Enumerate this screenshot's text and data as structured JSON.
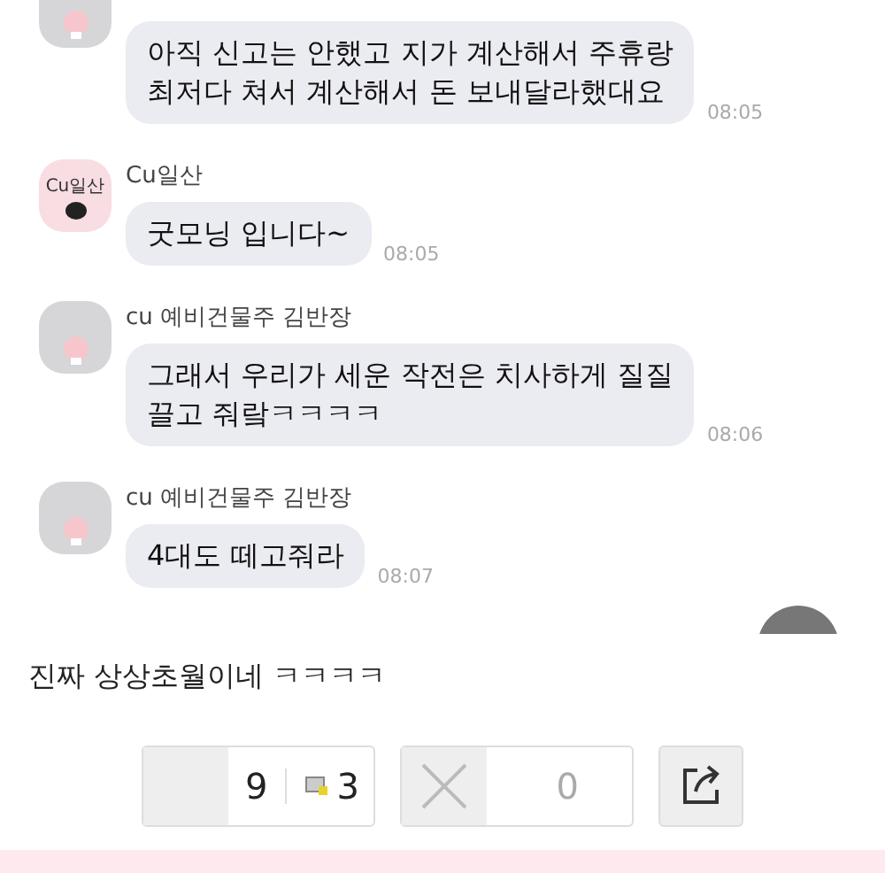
{
  "messages": [
    {
      "avatar": {
        "kind": "peach"
      },
      "text": "아직 신고는 안했고 지가 계산해서 주휴랑\n최저다 쳐서 계산해서 돈 보내달라했대요",
      "time": "08:05"
    },
    {
      "sender": "Cu일산",
      "avatar": {
        "kind": "label",
        "label": "Cu일산"
      },
      "text": "굿모닝 입니다~",
      "time": "08:05"
    },
    {
      "sender": "cu 예비건물주 김반장",
      "avatar": {
        "kind": "peach"
      },
      "text": "그래서 우리가 세운 작전은 치사하게 질질\n끌고 줘랔ㅋㅋㅋㅋ",
      "time": "08:06"
    },
    {
      "sender": "cu 예비건물주 김반장",
      "avatar": {
        "kind": "peach"
      },
      "text": "4대도 떼고줘라",
      "time": "08:07"
    }
  ],
  "comment": "진짜 상상초월이네 ㅋㅋㅋㅋ",
  "actions": {
    "upvotes": "9",
    "comments": "3",
    "downvotes": "0"
  }
}
